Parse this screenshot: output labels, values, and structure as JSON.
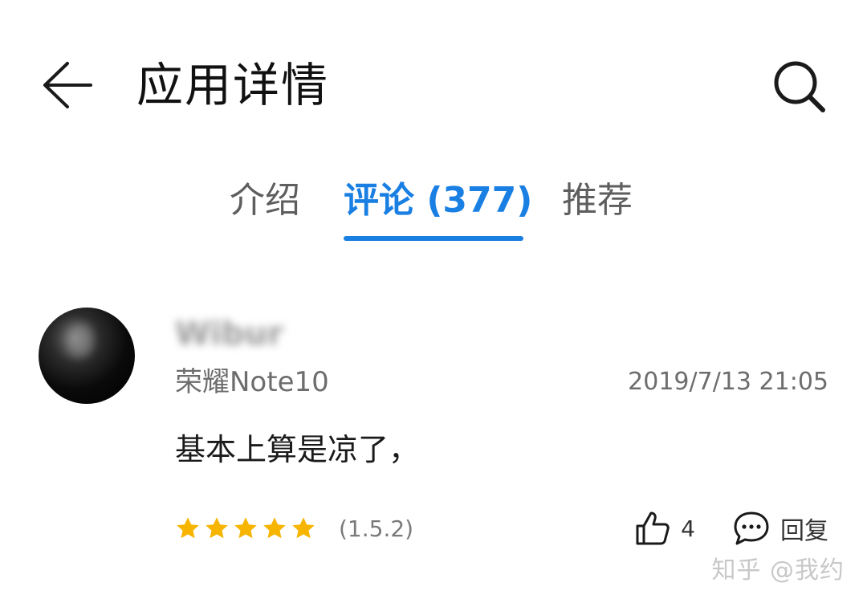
{
  "header": {
    "title": "应用详情",
    "back_icon": "arrow-left-icon",
    "search_icon": "search-icon"
  },
  "tabs": [
    {
      "label": "介绍",
      "active": false
    },
    {
      "label": "评论 (377)",
      "active": true
    },
    {
      "label": "推荐",
      "active": false
    }
  ],
  "colors": {
    "accent": "#1a7fe3",
    "star": "#f7b500"
  },
  "review": {
    "username": "Wibur",
    "device": "荣耀Note10",
    "timestamp": "2019/7/13 21:05",
    "text": "基本上算是凉了，",
    "rating": 5,
    "rating_max": 5,
    "version": "(1.5.2)",
    "likes": "4",
    "reply_label": "回复"
  },
  "watermark": "知乎 @我约"
}
